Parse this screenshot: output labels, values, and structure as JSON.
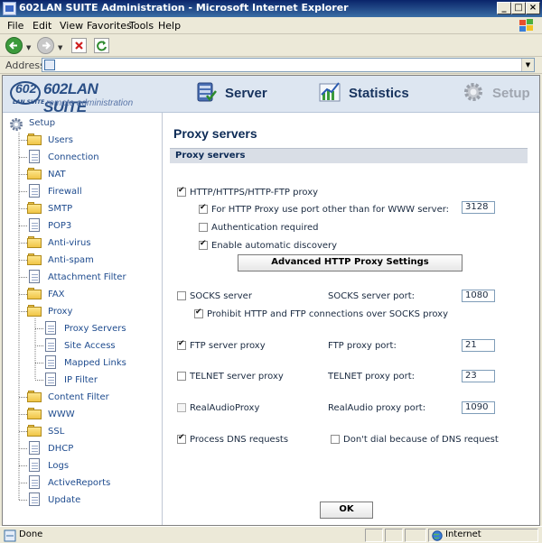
{
  "window": {
    "title": "602LAN SUITE Administration - Microsoft Internet Explorer"
  },
  "menu": {
    "file": "File",
    "edit": "Edit",
    "view": "View",
    "favorites": "Favorites",
    "tools": "Tools",
    "help": "Help"
  },
  "address": {
    "label": "Address",
    "value": ""
  },
  "logo": {
    "badge": "602",
    "badge_sub": "LAN SUITE",
    "brand": "602LAN SUITE",
    "tagline": "remote administration"
  },
  "nav": {
    "server": "Server",
    "statistics": "Statistics",
    "setup": "Setup"
  },
  "sidebar": {
    "root": "Setup",
    "items": [
      {
        "label": "Users",
        "icon": "folder-icon"
      },
      {
        "label": "Connection",
        "icon": "document-icon"
      },
      {
        "label": "NAT",
        "icon": "folder-icon"
      },
      {
        "label": "Firewall",
        "icon": "document-icon"
      },
      {
        "label": "SMTP",
        "icon": "folder-icon"
      },
      {
        "label": "POP3",
        "icon": "document-icon"
      },
      {
        "label": "Anti-virus",
        "icon": "folder-icon"
      },
      {
        "label": "Anti-spam",
        "icon": "folder-icon"
      },
      {
        "label": "Attachment Filter",
        "icon": "document-icon"
      },
      {
        "label": "FAX",
        "icon": "folder-icon"
      },
      {
        "label": "Proxy",
        "icon": "folder-icon"
      },
      {
        "label": "Proxy Servers",
        "icon": "document-icon"
      },
      {
        "label": "Site Access",
        "icon": "document-icon"
      },
      {
        "label": "Mapped Links",
        "icon": "document-icon"
      },
      {
        "label": "IP Filter",
        "icon": "document-icon"
      },
      {
        "label": "Content Filter",
        "icon": "folder-icon"
      },
      {
        "label": "WWW",
        "icon": "folder-icon"
      },
      {
        "label": "SSL",
        "icon": "folder-icon"
      },
      {
        "label": "DHCP",
        "icon": "document-icon"
      },
      {
        "label": "Logs",
        "icon": "document-icon"
      },
      {
        "label": "ActiveReports",
        "icon": "document-icon"
      },
      {
        "label": "Update",
        "icon": "document-icon"
      }
    ]
  },
  "main": {
    "title": "Proxy servers",
    "section": "Proxy servers",
    "http_proxy": "HTTP/HTTPS/HTTP-FTP proxy",
    "http_port_other": "For HTTP Proxy use port other than for WWW server:",
    "http_port_value": "3128",
    "auth_required": "Authentication required",
    "auto_discovery": "Enable automatic discovery",
    "advanced_button": "Advanced HTTP Proxy Settings",
    "socks_server": "SOCKS server",
    "socks_port_label": "SOCKS server port:",
    "socks_port_value": "1080",
    "prohibit_socks": "Prohibit HTTP and FTP connections over SOCKS proxy",
    "ftp_proxy": "FTP server proxy",
    "ftp_port_label": "FTP proxy port:",
    "ftp_port_value": "21",
    "telnet_proxy": "TELNET server proxy",
    "telnet_port_label": "TELNET proxy port:",
    "telnet_port_value": "23",
    "realaudio_proxy": "RealAudioProxy",
    "realaudio_port_label": "RealAudio proxy port:",
    "realaudio_port_value": "1090",
    "process_dns": "Process DNS requests",
    "dont_dial": "Don't dial because of DNS request",
    "ok_button": "OK"
  },
  "status": {
    "left": "Done",
    "zone": "Internet"
  }
}
